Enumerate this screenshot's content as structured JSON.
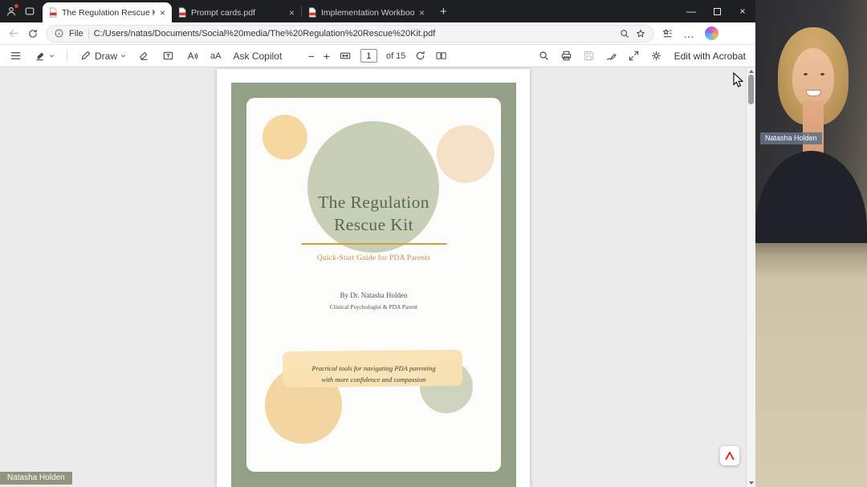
{
  "window": {
    "tabs": [
      {
        "title": "The Regulation Rescue Kit.pdf"
      },
      {
        "title": "Prompt cards.pdf"
      },
      {
        "title": "Implementation Workbook.pdf"
      }
    ],
    "new_tab_glyph": "+",
    "minimize_glyph": "—",
    "close_glyph": "×",
    "tab_close_glyph": "×"
  },
  "navbar": {
    "file_badge": "File",
    "url": "C:/Users/natas/Documents/Social%20media/The%20Regulation%20Rescue%20Kit.pdf",
    "more_glyph": "…"
  },
  "pdf_toolbar": {
    "draw_label": "Draw",
    "translate_glyph": "aA",
    "ask_copilot_label": "Ask Copilot",
    "zoom_out_glyph": "−",
    "zoom_in_glyph": "+",
    "page_number": "1",
    "page_total_label": "of 15",
    "edit_with_acrobat_label": "Edit with Acrobat"
  },
  "cover": {
    "title_line1": "The Regulation",
    "title_line2": "Rescue Kit",
    "subtitle": "Quick-Start Guide for PDA Parents",
    "byline": "By Dr. Natasha Holden",
    "byline_role": "Clinical Psychologist & PDA Parent",
    "tagline_line1": "Practical tools for navigating PDA parenting",
    "tagline_line2": "with more confidence and compassion"
  },
  "webcam": {
    "name_label": "Natasha Holden"
  },
  "overlay": {
    "presenter_label": "Natasha Holden"
  },
  "colors": {
    "cover_green": "#92A086",
    "circle_sage": "#C7CFB6",
    "circle_peach": "#F6D7A0",
    "title_green": "#55694E",
    "divider_gold": "#C9A23E",
    "subtitle_gold": "#BF8F4F",
    "tagline_highlight": "#F9E2B2",
    "titlebar_dark": "#1E1F22",
    "acrobat_red": "#E2231A"
  }
}
